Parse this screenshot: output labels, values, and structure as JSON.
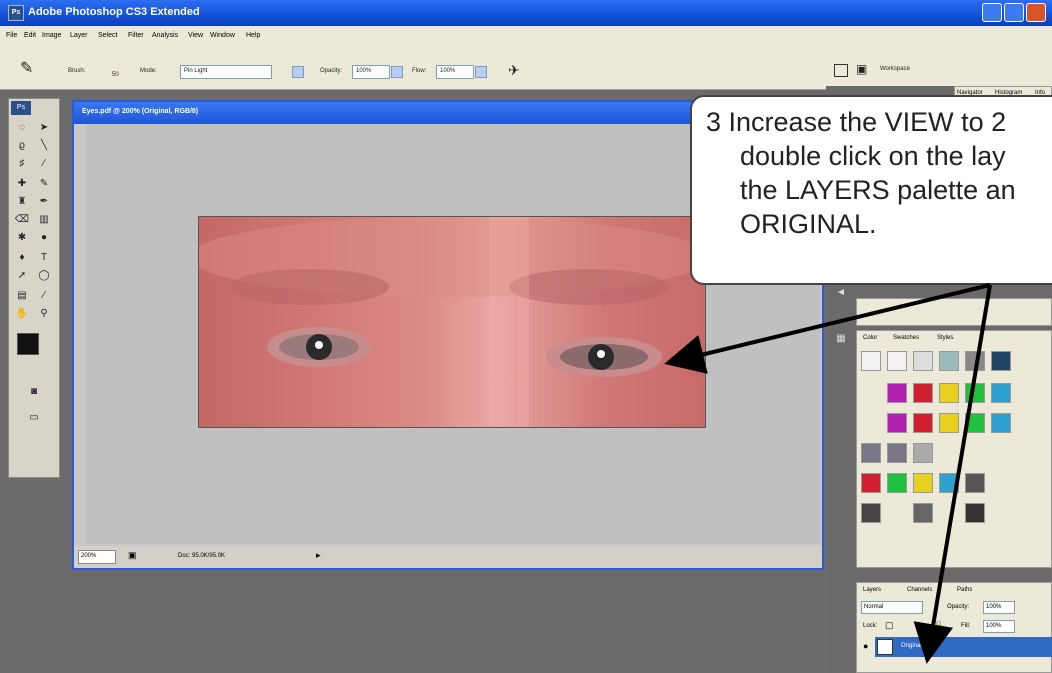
{
  "app": {
    "title": "Adobe Photoshop CS3 Extended",
    "logo": "Ps"
  },
  "menu": [
    "File",
    "Edit",
    "Image",
    "Layer",
    "Select",
    "Filter",
    "Analysis",
    "View",
    "Window",
    "Help"
  ],
  "options": {
    "brush_label": "Brush:",
    "brush_size": "50",
    "mode_label": "Mode:",
    "mode_value": "Pin Light",
    "opacity_label": "Opacity:",
    "opacity_value": "100%",
    "flow_label": "Flow:",
    "flow_value": "100%",
    "workspace_label": "Workspace"
  },
  "document": {
    "title": "Eyes.pdf @ 200% (Original, RGB/8)",
    "zoom": "200%",
    "doc_size": "Doc: 95.0K/95.0K"
  },
  "panels": {
    "navigator_tabs": [
      "Navigator",
      "Histogram",
      "Info"
    ],
    "swatch_tabs": [
      "Color",
      "Swatches",
      "Styles"
    ],
    "layers_tabs": [
      "Layers",
      "Channels",
      "Paths"
    ],
    "blend_mode": "Normal",
    "opacity_label": "Opacity:",
    "opacity_value": "100%",
    "lock_label": "Lock:",
    "fill_label": "Fill:",
    "fill_value": "100%",
    "layer_name": "Original"
  },
  "callout": {
    "lines": [
      "3  Increase the VIEW to 2",
      "double click on the lay",
      "the LAYERS palette an",
      "ORIGINAL."
    ]
  },
  "colors": {
    "title_bar": "#1350d8",
    "panel_bg": "#ece9d8",
    "layer_selected": "#316ac5",
    "arrow": "#000000"
  }
}
